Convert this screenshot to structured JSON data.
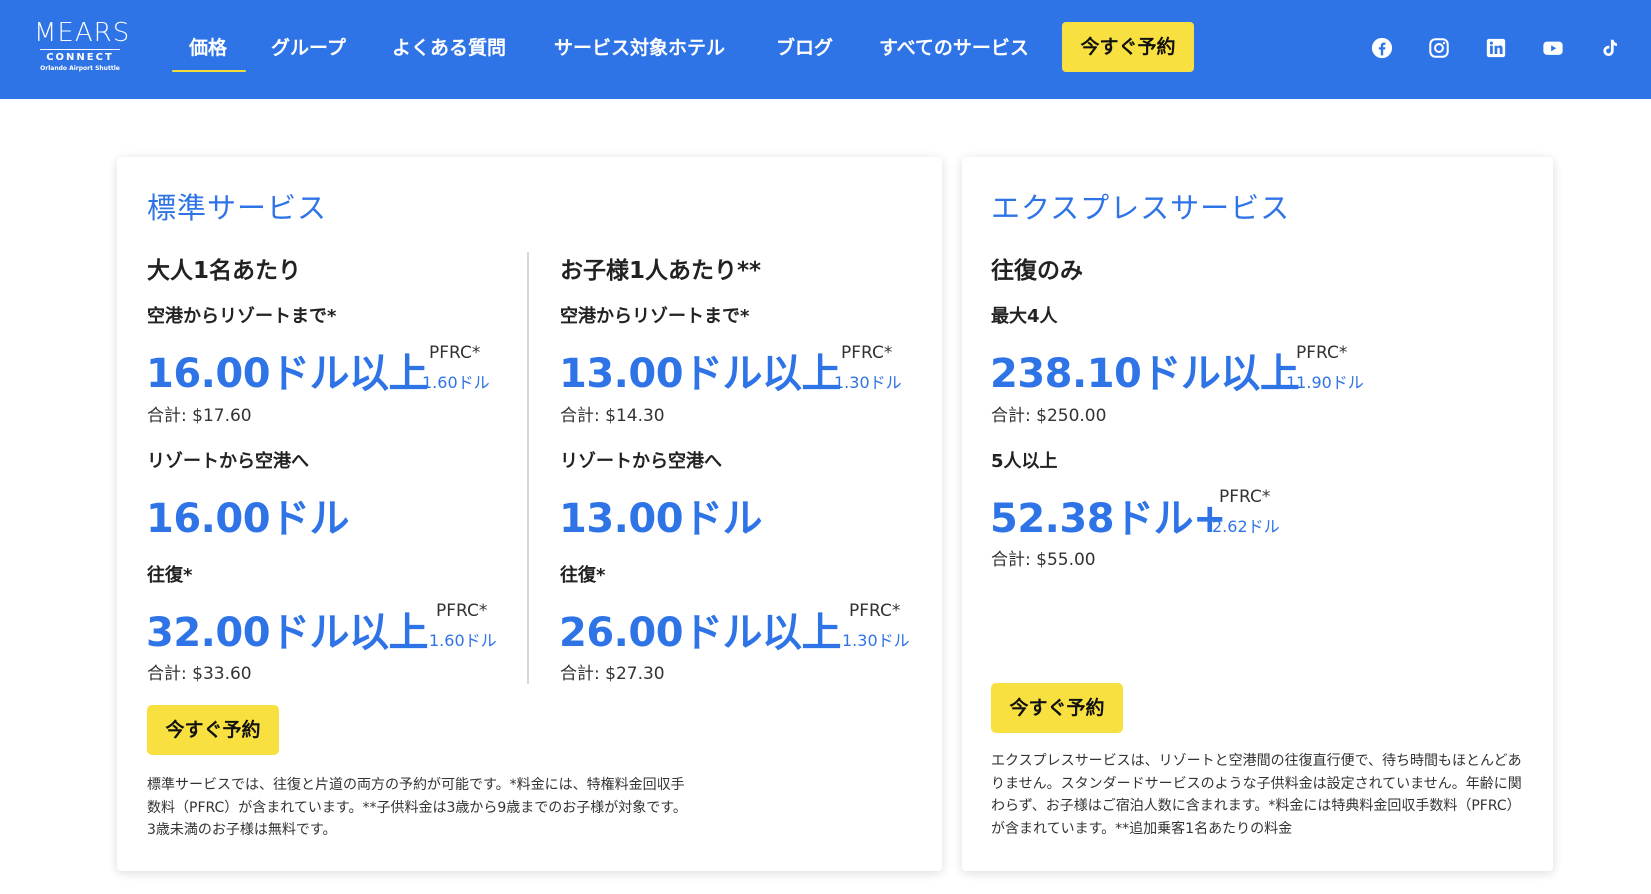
{
  "brand": {
    "name": "MEARS",
    "sub": "CONNECT",
    "tagline": "Orlando Airport Shuttle"
  },
  "nav": {
    "items": [
      {
        "label": "価格",
        "active": true
      },
      {
        "label": "グループ"
      },
      {
        "label": "よくある質問"
      },
      {
        "label": "サービス対象ホテル"
      },
      {
        "label": "ブログ"
      },
      {
        "label": "すべてのサービス"
      }
    ],
    "cta": "今すぐ予約"
  },
  "social": [
    "facebook-icon",
    "instagram-icon",
    "linkedin-icon",
    "youtube-icon",
    "tiktok-icon"
  ],
  "colors": {
    "header": "#2f74e6",
    "accent": "#2f74e6",
    "button": "#f8e041"
  },
  "standard": {
    "title": "標準サービス",
    "adult": {
      "heading": "大人1名あたり",
      "to_resort_label": "空港からリゾートまで*",
      "to_resort_price": "16.00ドル以上",
      "to_resort_pfrc_label": "PFRC*",
      "to_resort_pfrc": "1.60ドル",
      "to_resort_total": "合計: $17.60",
      "to_airport_label": "リゾートから空港へ",
      "to_airport_price": "16.00ドル",
      "round_label": "往復*",
      "round_price": "32.00ドル以上",
      "round_pfrc_label": "PFRC*",
      "round_pfrc": "1.60ドル",
      "round_total": "合計: $33.60"
    },
    "child": {
      "heading": "お子様1人あたり**",
      "to_resort_label": "空港からリゾートまで*",
      "to_resort_price": "13.00ドル以上",
      "to_resort_pfrc_label": "PFRC*",
      "to_resort_pfrc": "1.30ドル",
      "to_resort_total": "合計: $14.30",
      "to_airport_label": "リゾートから空港へ",
      "to_airport_price": "13.00ドル",
      "round_label": "往復*",
      "round_price": "26.00ドル以上",
      "round_pfrc_label": "PFRC*",
      "round_pfrc": "1.30ドル",
      "round_total": "合計: $27.30"
    },
    "button": "今すぐ予約",
    "note": "標準サービスでは、往復と片道の両方の予約が可能です。*料金には、特権料金回収手数料（PFRC）が含まれています。**子供料金は3歳から9歳までのお子様が対象です。3歳未満のお子様は無料です。"
  },
  "express": {
    "title": "エクスプレスサービス",
    "heading": "往復のみ",
    "up_to_4_label": "最大4人",
    "up_to_4_price": "238.10ドル以上",
    "up_to_4_pfrc_label": "PFRC*",
    "up_to_4_pfrc": "11.90ドル",
    "up_to_4_total": "合計: $250.00",
    "five_plus_label": "5人以上",
    "five_plus_price": "52.38ドル+",
    "five_plus_pfrc_label": "PFRC*",
    "five_plus_pfrc": "2.62ドル",
    "five_plus_total": "合計: $55.00",
    "button": "今すぐ予約",
    "note": "エクスプレスサービスは、リゾートと空港間の往復直行便で、待ち時間もほとんどありません。スタンダードサービスのような子供料金は設定されていません。年齢に関わらず、お子様はご宿泊人数に含まれます。*料金には特典料金回収手数料（PFRC）が含まれています。**追加乗客1名あたりの料金"
  }
}
